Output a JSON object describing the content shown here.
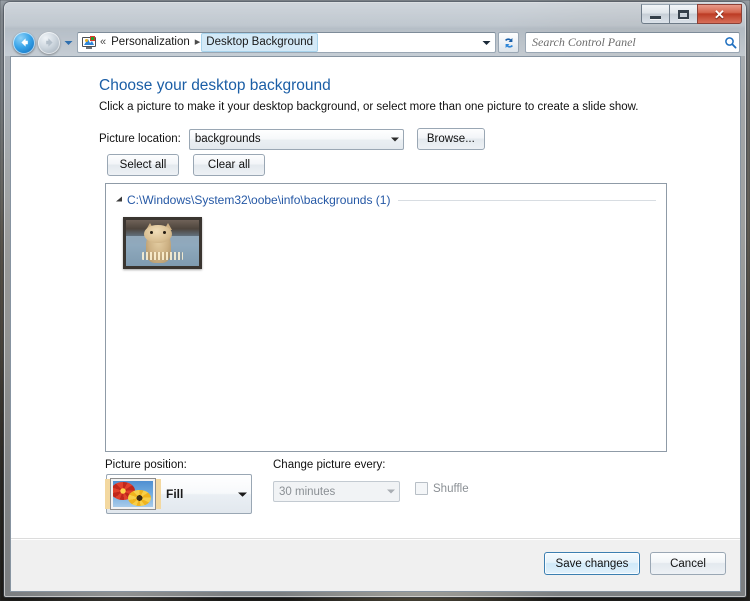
{
  "window": {
    "controls": {
      "minimize": "minimize-button",
      "maximize": "restore-button",
      "close_glyph": "✕"
    }
  },
  "nav": {
    "back_label": "Back",
    "forward_label": "Forward",
    "recent_pages_label": "Recent pages",
    "refresh_label": "Refresh",
    "breadcrumb": {
      "overflow": "«",
      "separator": "▸",
      "items": [
        {
          "label": "Personalization",
          "active": false
        },
        {
          "label": "Desktop Background",
          "active": true
        }
      ]
    }
  },
  "search": {
    "placeholder": "Search Control Panel",
    "value": ""
  },
  "main": {
    "title": "Choose your desktop background",
    "subtitle": "Click a picture to make it your desktop background, or select more than one picture to create a slide show.",
    "picture_location": {
      "label": "Picture location:",
      "value": "backgrounds",
      "browse_label": "Browse..."
    },
    "toolbar": {
      "select_all_label": "Select all",
      "clear_all_label": "Clear all"
    },
    "list": {
      "group_path": "C:\\Windows\\System32\\oobe\\info\\backgrounds (1)",
      "item_count": 1,
      "items": [
        {
          "name": "backgroundDefault",
          "selected": false
        }
      ]
    },
    "picture_position": {
      "label": "Picture position:",
      "value": "Fill"
    },
    "change_picture": {
      "label": "Change picture every:",
      "value": "30 minutes",
      "disabled": true
    },
    "shuffle": {
      "label": "Shuffle",
      "checked": false,
      "disabled": true
    }
  },
  "commandbar": {
    "save_label": "Save changes",
    "cancel_label": "Cancel"
  },
  "colors": {
    "title_blue": "#1b5ea6",
    "link_blue": "#2558a5",
    "crumb_highlight": "#d3e9f7",
    "default_button_border": "#3c7fb1",
    "close_red": "#bc3b24"
  }
}
